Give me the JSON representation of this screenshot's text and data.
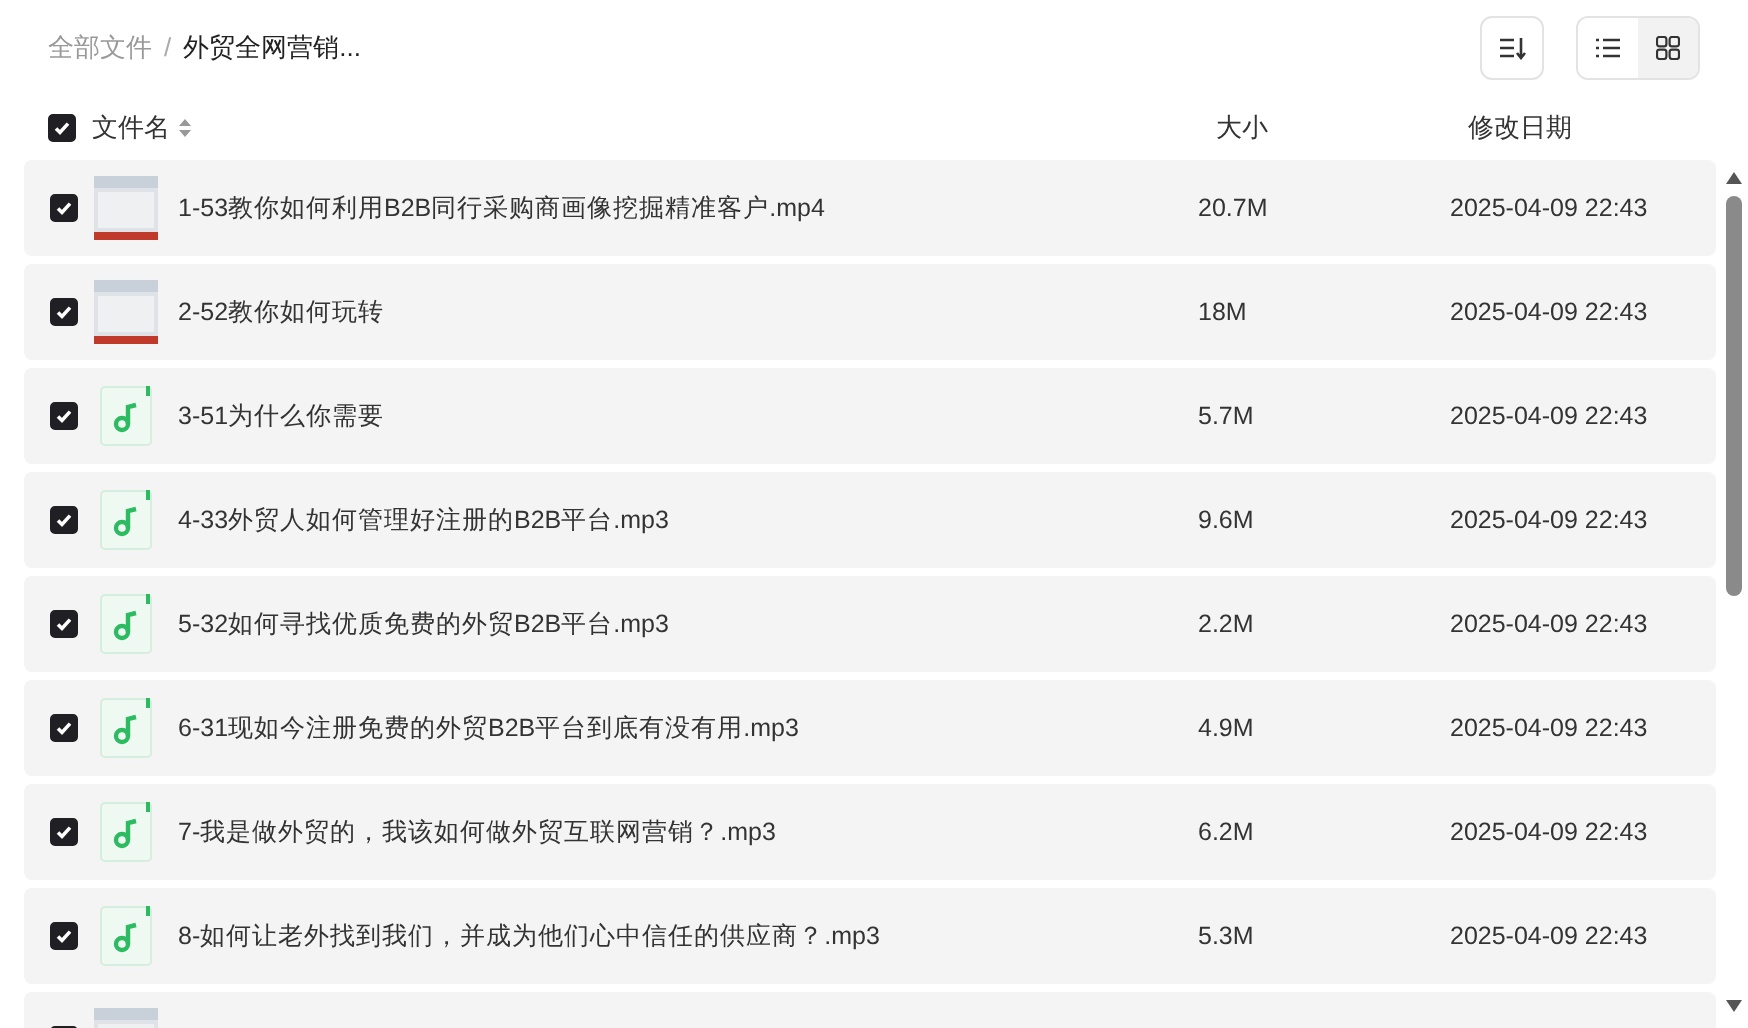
{
  "breadcrumb": [
    {
      "label": "全部文件",
      "current": false
    },
    {
      "label": "外贸全网营销...",
      "current": true
    }
  ],
  "breadcrumb_separator": "/",
  "toolbar": {
    "view_modes": [
      {
        "kind": "list",
        "selected": false
      },
      {
        "kind": "grid",
        "selected": true
      }
    ]
  },
  "table": {
    "select_all": {
      "checked": true
    },
    "columns": [
      "文件名",
      "大小",
      "修改日期"
    ],
    "rows": [
      {
        "kind": "video",
        "checked": true,
        "name": "1-53教你如何利用B2B同行采购商画像挖掘精准客户.mp4",
        "size": "20.7M",
        "modified": "2025-04-09 22:43"
      },
      {
        "kind": "video",
        "checked": true,
        "name": "2-52教你如何玩转",
        "size": "18M",
        "modified": "2025-04-09 22:43"
      },
      {
        "kind": "audio",
        "checked": true,
        "name": "3-51为什么你需要",
        "size": "5.7M",
        "modified": "2025-04-09 22:43"
      },
      {
        "kind": "audio",
        "checked": true,
        "name": "4-33外贸人如何管理好注册的B2B平台.mp3",
        "size": "9.6M",
        "modified": "2025-04-09 22:43"
      },
      {
        "kind": "audio",
        "checked": true,
        "name": "5-32如何寻找优质免费的外贸B2B平台.mp3",
        "size": "2.2M",
        "modified": "2025-04-09 22:43"
      },
      {
        "kind": "audio",
        "checked": true,
        "name": "6-31现如今注册免费的外贸B2B平台到底有没有用.mp3",
        "size": "4.9M",
        "modified": "2025-04-09 22:43"
      },
      {
        "kind": "audio",
        "checked": true,
        "name": "7-我是做外贸的，我该如何做外贸互联网营销？.mp3",
        "size": "6.2M",
        "modified": "2025-04-09 22:43"
      },
      {
        "kind": "audio",
        "checked": true,
        "name": "8-如何让老外找到我们，并成为他们心中信任的供应商？.mp3",
        "size": "5.3M",
        "modified": "2025-04-09 22:43"
      },
      {
        "kind": "video",
        "checked": true
      }
    ]
  }
}
